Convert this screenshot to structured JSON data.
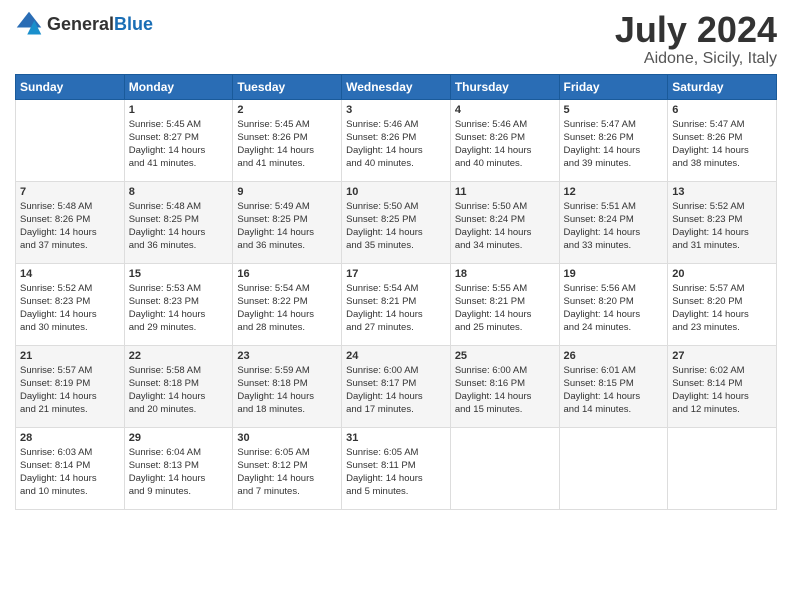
{
  "logo": {
    "general": "General",
    "blue": "Blue"
  },
  "header": {
    "month": "July 2024",
    "location": "Aidone, Sicily, Italy"
  },
  "weekdays": [
    "Sunday",
    "Monday",
    "Tuesday",
    "Wednesday",
    "Thursday",
    "Friday",
    "Saturday"
  ],
  "weeks": [
    [
      {
        "day": "",
        "info": ""
      },
      {
        "day": "1",
        "info": "Sunrise: 5:45 AM\nSunset: 8:27 PM\nDaylight: 14 hours\nand 41 minutes."
      },
      {
        "day": "2",
        "info": "Sunrise: 5:45 AM\nSunset: 8:26 PM\nDaylight: 14 hours\nand 41 minutes."
      },
      {
        "day": "3",
        "info": "Sunrise: 5:46 AM\nSunset: 8:26 PM\nDaylight: 14 hours\nand 40 minutes."
      },
      {
        "day": "4",
        "info": "Sunrise: 5:46 AM\nSunset: 8:26 PM\nDaylight: 14 hours\nand 40 minutes."
      },
      {
        "day": "5",
        "info": "Sunrise: 5:47 AM\nSunset: 8:26 PM\nDaylight: 14 hours\nand 39 minutes."
      },
      {
        "day": "6",
        "info": "Sunrise: 5:47 AM\nSunset: 8:26 PM\nDaylight: 14 hours\nand 38 minutes."
      }
    ],
    [
      {
        "day": "7",
        "info": "Sunrise: 5:48 AM\nSunset: 8:26 PM\nDaylight: 14 hours\nand 37 minutes."
      },
      {
        "day": "8",
        "info": "Sunrise: 5:48 AM\nSunset: 8:25 PM\nDaylight: 14 hours\nand 36 minutes."
      },
      {
        "day": "9",
        "info": "Sunrise: 5:49 AM\nSunset: 8:25 PM\nDaylight: 14 hours\nand 36 minutes."
      },
      {
        "day": "10",
        "info": "Sunrise: 5:50 AM\nSunset: 8:25 PM\nDaylight: 14 hours\nand 35 minutes."
      },
      {
        "day": "11",
        "info": "Sunrise: 5:50 AM\nSunset: 8:24 PM\nDaylight: 14 hours\nand 34 minutes."
      },
      {
        "day": "12",
        "info": "Sunrise: 5:51 AM\nSunset: 8:24 PM\nDaylight: 14 hours\nand 33 minutes."
      },
      {
        "day": "13",
        "info": "Sunrise: 5:52 AM\nSunset: 8:23 PM\nDaylight: 14 hours\nand 31 minutes."
      }
    ],
    [
      {
        "day": "14",
        "info": "Sunrise: 5:52 AM\nSunset: 8:23 PM\nDaylight: 14 hours\nand 30 minutes."
      },
      {
        "day": "15",
        "info": "Sunrise: 5:53 AM\nSunset: 8:23 PM\nDaylight: 14 hours\nand 29 minutes."
      },
      {
        "day": "16",
        "info": "Sunrise: 5:54 AM\nSunset: 8:22 PM\nDaylight: 14 hours\nand 28 minutes."
      },
      {
        "day": "17",
        "info": "Sunrise: 5:54 AM\nSunset: 8:21 PM\nDaylight: 14 hours\nand 27 minutes."
      },
      {
        "day": "18",
        "info": "Sunrise: 5:55 AM\nSunset: 8:21 PM\nDaylight: 14 hours\nand 25 minutes."
      },
      {
        "day": "19",
        "info": "Sunrise: 5:56 AM\nSunset: 8:20 PM\nDaylight: 14 hours\nand 24 minutes."
      },
      {
        "day": "20",
        "info": "Sunrise: 5:57 AM\nSunset: 8:20 PM\nDaylight: 14 hours\nand 23 minutes."
      }
    ],
    [
      {
        "day": "21",
        "info": "Sunrise: 5:57 AM\nSunset: 8:19 PM\nDaylight: 14 hours\nand 21 minutes."
      },
      {
        "day": "22",
        "info": "Sunrise: 5:58 AM\nSunset: 8:18 PM\nDaylight: 14 hours\nand 20 minutes."
      },
      {
        "day": "23",
        "info": "Sunrise: 5:59 AM\nSunset: 8:18 PM\nDaylight: 14 hours\nand 18 minutes."
      },
      {
        "day": "24",
        "info": "Sunrise: 6:00 AM\nSunset: 8:17 PM\nDaylight: 14 hours\nand 17 minutes."
      },
      {
        "day": "25",
        "info": "Sunrise: 6:00 AM\nSunset: 8:16 PM\nDaylight: 14 hours\nand 15 minutes."
      },
      {
        "day": "26",
        "info": "Sunrise: 6:01 AM\nSunset: 8:15 PM\nDaylight: 14 hours\nand 14 minutes."
      },
      {
        "day": "27",
        "info": "Sunrise: 6:02 AM\nSunset: 8:14 PM\nDaylight: 14 hours\nand 12 minutes."
      }
    ],
    [
      {
        "day": "28",
        "info": "Sunrise: 6:03 AM\nSunset: 8:14 PM\nDaylight: 14 hours\nand 10 minutes."
      },
      {
        "day": "29",
        "info": "Sunrise: 6:04 AM\nSunset: 8:13 PM\nDaylight: 14 hours\nand 9 minutes."
      },
      {
        "day": "30",
        "info": "Sunrise: 6:05 AM\nSunset: 8:12 PM\nDaylight: 14 hours\nand 7 minutes."
      },
      {
        "day": "31",
        "info": "Sunrise: 6:05 AM\nSunset: 8:11 PM\nDaylight: 14 hours\nand 5 minutes."
      },
      {
        "day": "",
        "info": ""
      },
      {
        "day": "",
        "info": ""
      },
      {
        "day": "",
        "info": ""
      }
    ]
  ]
}
